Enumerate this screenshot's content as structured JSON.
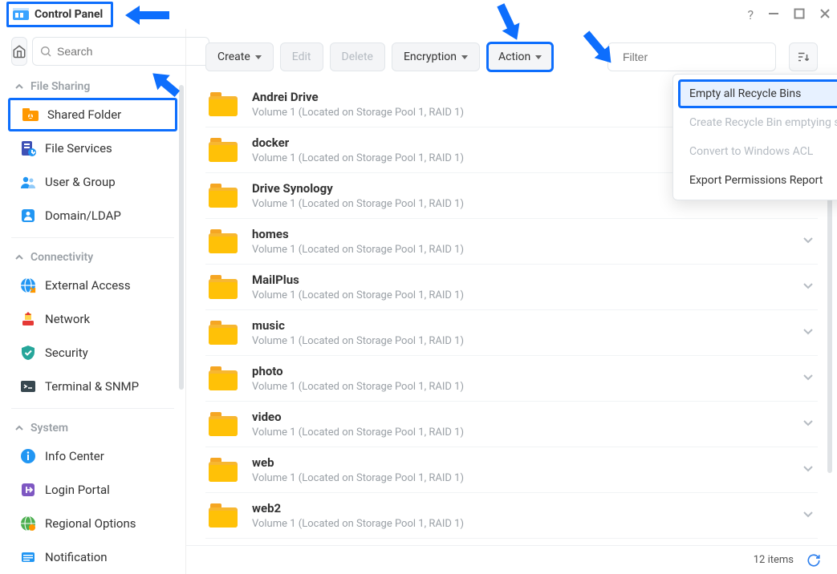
{
  "window": {
    "title": "Control Panel"
  },
  "sidebar": {
    "search_placeholder": "Search",
    "sections": {
      "file_sharing": {
        "label": "File Sharing"
      },
      "connectivity": {
        "label": "Connectivity"
      },
      "system": {
        "label": "System"
      }
    },
    "items": {
      "shared_folder": {
        "label": "Shared Folder"
      },
      "file_services": {
        "label": "File Services"
      },
      "user_group": {
        "label": "User & Group"
      },
      "domain_ldap": {
        "label": "Domain/LDAP"
      },
      "external_access": {
        "label": "External Access"
      },
      "network": {
        "label": "Network"
      },
      "security": {
        "label": "Security"
      },
      "terminal_snmp": {
        "label": "Terminal & SNMP"
      },
      "info_center": {
        "label": "Info Center"
      },
      "login_portal": {
        "label": "Login Portal"
      },
      "regional_options": {
        "label": "Regional Options"
      },
      "notification": {
        "label": "Notification"
      }
    }
  },
  "toolbar": {
    "create": "Create",
    "edit": "Edit",
    "delete": "Delete",
    "encryption": "Encryption",
    "action": "Action",
    "filter_placeholder": "Filter"
  },
  "action_menu": {
    "empty_all": "Empty all Recycle Bins",
    "create_schedule": "Create Recycle Bin emptying schedule",
    "convert_acl": "Convert to Windows ACL",
    "export_perm": "Export Permissions Report"
  },
  "folders": [
    {
      "name": "Andrei Drive",
      "sub": "Volume 1 (Located on Storage Pool 1, RAID 1)"
    },
    {
      "name": "docker",
      "sub": "Volume 1 (Located on Storage Pool 1, RAID 1)"
    },
    {
      "name": "Drive Synology",
      "sub": "Volume 1 (Located on Storage Pool 1, RAID 1)"
    },
    {
      "name": "homes",
      "sub": "Volume 1 (Located on Storage Pool 1, RAID 1)"
    },
    {
      "name": "MailPlus",
      "sub": "Volume 1 (Located on Storage Pool 1, RAID 1)"
    },
    {
      "name": "music",
      "sub": "Volume 1 (Located on Storage Pool 1, RAID 1)"
    },
    {
      "name": "photo",
      "sub": "Volume 1 (Located on Storage Pool 1, RAID 1)"
    },
    {
      "name": "video",
      "sub": "Volume 1 (Located on Storage Pool 1, RAID 1)"
    },
    {
      "name": "web",
      "sub": "Volume 1 (Located on Storage Pool 1, RAID 1)"
    },
    {
      "name": "web2",
      "sub": "Volume 1 (Located on Storage Pool 1, RAID 1)"
    }
  ],
  "footer": {
    "count": "12 items"
  }
}
